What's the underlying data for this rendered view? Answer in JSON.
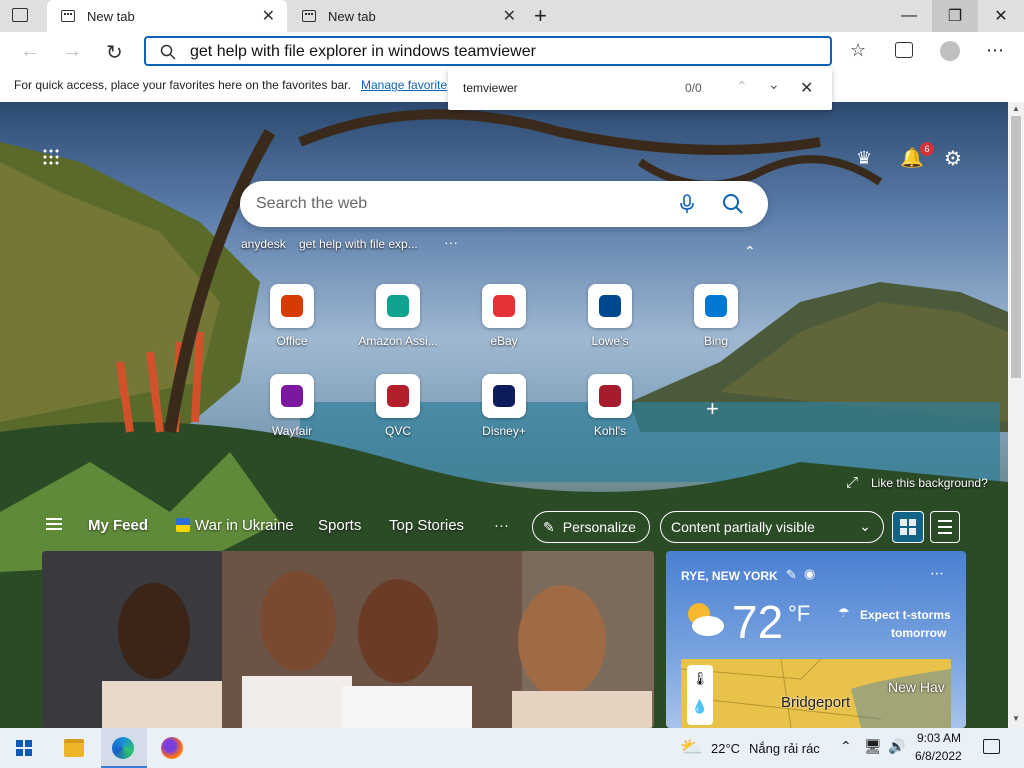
{
  "tabs": [
    {
      "label": "New tab"
    },
    {
      "label": "New tab"
    }
  ],
  "address": {
    "value": "get help with file explorer in windows teamviewer"
  },
  "favbar": {
    "text": "For quick access, place your favorites here on the favorites bar.",
    "link": "Manage favorites now"
  },
  "find": {
    "query": "temviewer",
    "count": "0/0"
  },
  "notifications": {
    "count": "6"
  },
  "search": {
    "placeholder": "Search the web",
    "suggestions": [
      "anydesk",
      "get help with file exp...",
      "···"
    ]
  },
  "tiles": [
    {
      "label": "Office",
      "icon": "office-icon",
      "color": "#d83b01"
    },
    {
      "label": "Amazon Assi...",
      "icon": "amazon-icon",
      "color": "#10a38e"
    },
    {
      "label": "eBay",
      "icon": "ebay-icon",
      "color": "#e53238"
    },
    {
      "label": "Lowe's",
      "icon": "lowes-icon",
      "color": "#004990"
    },
    {
      "label": "Bing",
      "icon": "bing-icon",
      "color": "#0078d4"
    },
    {
      "label": "Wayfair",
      "icon": "wayfair-icon",
      "color": "#7b189f"
    },
    {
      "label": "QVC",
      "icon": "qvc-icon",
      "color": "#b31e2b"
    },
    {
      "label": "Disney+",
      "icon": "disney-icon",
      "color": "#0d1c5b"
    },
    {
      "label": "Kohl's",
      "icon": "kohls-icon",
      "color": "#a51d2d"
    }
  ],
  "background_link": "Like this background?",
  "feed": {
    "menu": [
      "My Feed",
      "War in Ukraine",
      "Sports",
      "Top Stories",
      "···"
    ],
    "personalize": "Personalize",
    "content_select": "Content partially visible"
  },
  "weather": {
    "location": "RYE, NEW YORK",
    "temp": "72",
    "unit": "°F",
    "forecast_line1": "Expect t-storms",
    "forecast_line2": "tomorrow",
    "map_label1": "Bridgeport",
    "map_label2": "New Hav"
  },
  "taskbar": {
    "temp": "22°C",
    "weather": "Nắng rải rác",
    "time": "9:03 AM",
    "date": "6/8/2022"
  }
}
